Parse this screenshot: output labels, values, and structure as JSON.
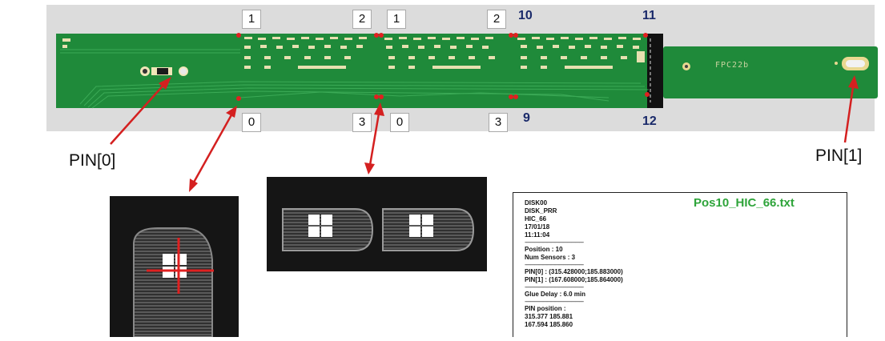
{
  "number_tags": {
    "top": [
      "1",
      "2",
      "1",
      "2"
    ],
    "bottom": [
      "0",
      "3",
      "0",
      "3"
    ]
  },
  "position_numbers": {
    "top_left": "10",
    "top_right": "11",
    "bottom_left": "9",
    "bottom_right": "12"
  },
  "board_text": "FPC22b",
  "pin_labels": {
    "left": "PIN[0]",
    "right": "PIN[1]"
  },
  "file": {
    "title": "Pos10_HIC_66.txt",
    "header_lines": [
      "DISK00",
      "DISK_PRR",
      "HIC_66",
      "17/01/18",
      "11:11:04"
    ],
    "separator": "--------------------------------------------",
    "position": "Position : 10",
    "num_sensors": "Num Sensors : 3",
    "pin0": "PIN[0] : (315.428000;185.883000)",
    "pin1": "PIN[1] : (167.608000;185.864000)",
    "glue_delay": "Glue Delay : 6.0 min",
    "pin_position_label": "PIN position :",
    "pin_position_1": "315.377 185.881",
    "pin_position_2": "167.594 185.860"
  },
  "colors": {
    "board": "#1f8a3a",
    "arrow": "#d42020",
    "title_green": "#2ea43a",
    "number_blue": "#1a2a6a"
  }
}
